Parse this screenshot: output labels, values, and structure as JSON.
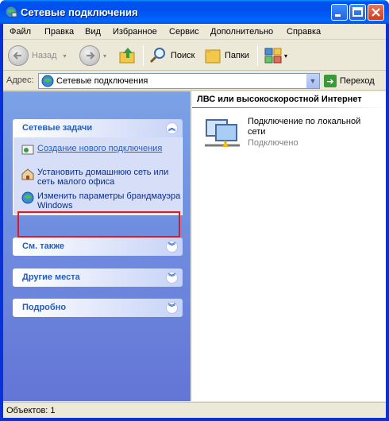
{
  "window": {
    "title": "Сетевые подключения"
  },
  "menu": [
    "Файл",
    "Правка",
    "Вид",
    "Избранное",
    "Сервис",
    "Дополнительно",
    "Справка"
  ],
  "toolbar": {
    "back": "Назад",
    "search": "Поиск",
    "folders": "Папки"
  },
  "address": {
    "label": "Адрес:",
    "value": "Сетевые подключения",
    "go": "Переход"
  },
  "sidebar": {
    "tasks": {
      "title": "Сетевые задачи",
      "items": [
        {
          "label": "Создание нового подключения",
          "icon": "new-connection-icon"
        },
        {
          "label": "Установить домашнюю сеть или сеть малого офиса",
          "icon": "home-network-icon"
        },
        {
          "label": "Изменить параметры брандмауэра Windows",
          "icon": "firewall-icon"
        }
      ]
    },
    "see_also": "См. также",
    "other_places": "Другие места",
    "details": "Подробно"
  },
  "content": {
    "group": "ЛВС или высокоскоростной Интернет",
    "connection": {
      "name": "Подключение по локальной сети",
      "status": "Подключено",
      "icon": "lan-connection-icon"
    }
  },
  "status": "Объектов: 1"
}
